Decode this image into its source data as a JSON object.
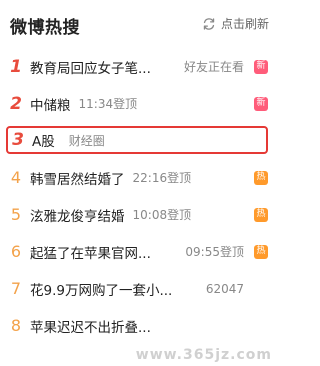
{
  "header": {
    "title": "微博热搜",
    "refresh_label": "点击刷新"
  },
  "items": [
    {
      "rank": "1",
      "topic": "教育局回应女子笔...",
      "meta": "好友正在看",
      "badge": "新",
      "badge_type": "new"
    },
    {
      "rank": "2",
      "topic": "中储粮",
      "meta": "11:34登顶",
      "badge": "新",
      "badge_type": "new"
    },
    {
      "rank": "3",
      "topic": "A股",
      "meta": "财经圈",
      "badge": "",
      "badge_type": ""
    },
    {
      "rank": "4",
      "topic": "韩雪居然结婚了",
      "meta": "22:16登顶",
      "badge": "热",
      "badge_type": "hot"
    },
    {
      "rank": "5",
      "topic": "泫雅龙俊亨结婚",
      "meta": "10:08登顶",
      "badge": "热",
      "badge_type": "hot"
    },
    {
      "rank": "6",
      "topic": "起猛了在苹果官网...",
      "meta": "09:55登顶",
      "badge": "热",
      "badge_type": "hot"
    },
    {
      "rank": "7",
      "topic": "花9.9万网购了一套小...",
      "meta": "62047",
      "badge": "",
      "badge_type": ""
    },
    {
      "rank": "8",
      "topic": "苹果迟迟不出折叠...",
      "meta": "",
      "badge": "",
      "badge_type": ""
    }
  ],
  "watermark": "www.365jz.com",
  "colors": {
    "accent_red": "#e84c3d",
    "rank_orange": "#f3a24a",
    "badge_new": "#ff5c7a",
    "badge_hot": "#ff9a2b",
    "highlight_border": "#e53935"
  }
}
